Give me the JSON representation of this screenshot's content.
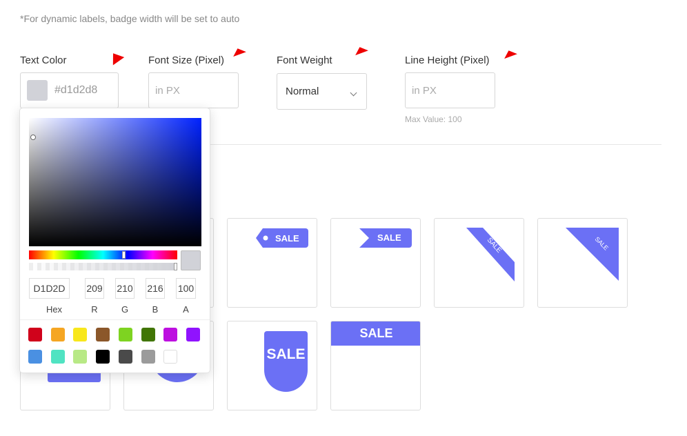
{
  "note": "*For dynamic labels, badge width will be set to auto",
  "text_color": {
    "label": "Text Color",
    "value": "#d1d2d8",
    "swatch": "#d1d2d8"
  },
  "font_size": {
    "label": "Font Size (Pixel)",
    "placeholder": "in PX"
  },
  "font_weight": {
    "label": "Font Weight",
    "value": "Normal"
  },
  "line_height": {
    "label": "Line Height (Pixel)",
    "placeholder": "in PX",
    "hint": "Max Value: 100"
  },
  "badge_color": "#6b70f5",
  "badge_text": "SALE",
  "picker": {
    "hex": "D1D2D",
    "r": "209",
    "g": "210",
    "b": "216",
    "a": "100",
    "labels": {
      "hex": "Hex",
      "r": "R",
      "g": "G",
      "b": "B",
      "a": "A"
    },
    "presets": [
      "#d0021b",
      "#f5a623",
      "#f8e71c",
      "#8b572a",
      "#7ed321",
      "#417505",
      "#bd10e0",
      "#9013fe",
      "#4a90e2",
      "#50e3c2",
      "#b8e986",
      "#000000",
      "#4a4a4a",
      "#9b9b9b",
      "#ffffff"
    ]
  }
}
